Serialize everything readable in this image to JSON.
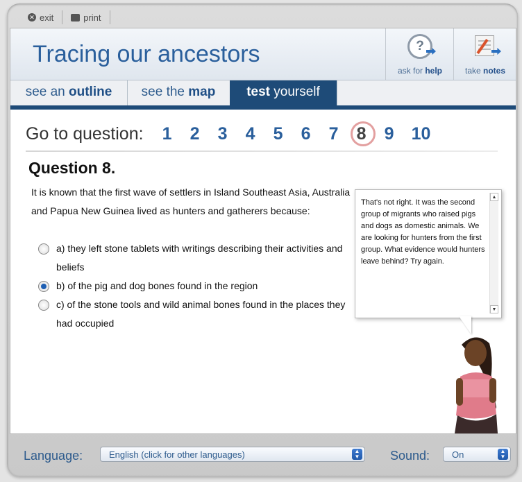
{
  "toolbar": {
    "exit_label": "exit",
    "print_label": "print"
  },
  "header": {
    "title": "Tracing our ancestors",
    "help": {
      "prefix": "ask for ",
      "bold": "help"
    },
    "notes": {
      "prefix": "take ",
      "bold": "notes"
    }
  },
  "tabs": [
    {
      "prefix": "see an ",
      "bold": "outline",
      "active": false
    },
    {
      "prefix": "see the ",
      "bold": "map",
      "active": false
    },
    {
      "bold": "test",
      "suffix": " yourself",
      "active": true
    }
  ],
  "goto": {
    "label": "Go to question:",
    "numbers": [
      "1",
      "2",
      "3",
      "4",
      "5",
      "6",
      "7",
      "8",
      "9",
      "10"
    ],
    "current": "8"
  },
  "question": {
    "title": "Question 8.",
    "prompt": "It is known that the first wave of settlers in Island Southeast Asia, Australia and Papua New Guinea lived as hunters and gatherers because:",
    "options": [
      {
        "text": "a) they left stone tablets with writings describing their activities and beliefs",
        "selected": false
      },
      {
        "text": "b) of the pig and dog bones found in the region",
        "selected": true
      },
      {
        "text": "c) of the stone tools and wild animal bones found in the places they had occupied",
        "selected": false
      }
    ]
  },
  "feedback": {
    "text": "That's not right. It was the second group of migrants who raised pigs and dogs as domestic animals. We are looking for hunters from the first group. What evidence would hunters leave behind? Try again."
  },
  "footer": {
    "language_label": "Language:",
    "language_value": "English (click for other languages)",
    "sound_label": "Sound:",
    "sound_value": "On"
  },
  "colors": {
    "accent": "#2a5f9c",
    "tab_active": "#1e4b78",
    "link_blue": "#2d5b8d"
  }
}
